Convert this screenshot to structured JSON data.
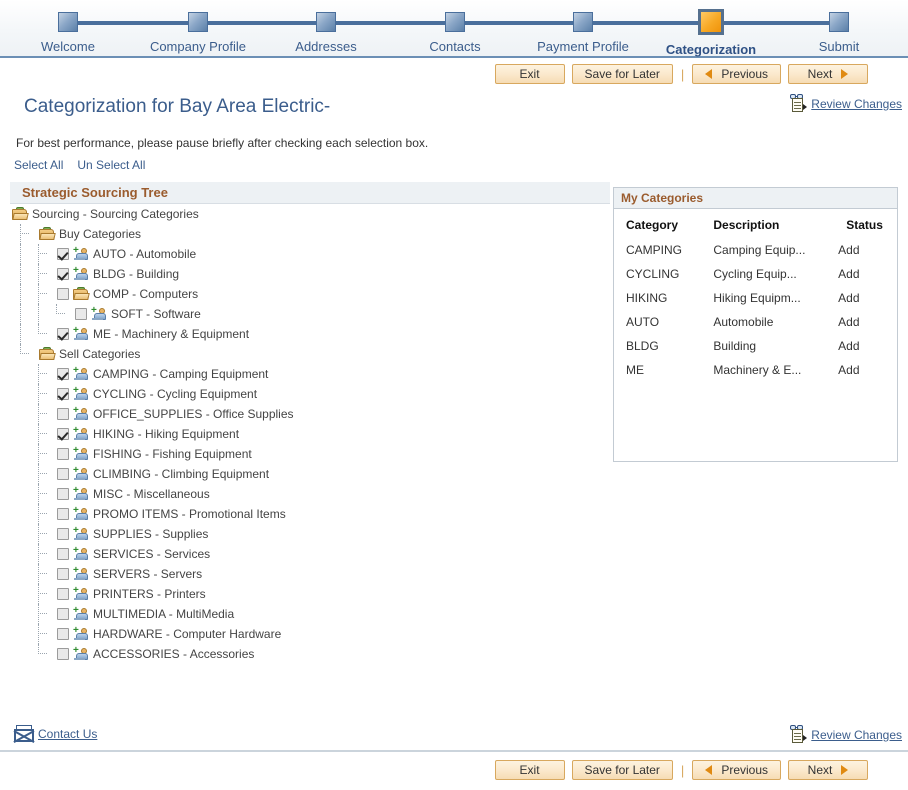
{
  "steps": [
    {
      "label": "Welcome",
      "current": false
    },
    {
      "label": "Company Profile",
      "current": false
    },
    {
      "label": "Addresses",
      "current": false
    },
    {
      "label": "Contacts",
      "current": false
    },
    {
      "label": "Payment Profile",
      "current": false
    },
    {
      "label": "Categorization",
      "current": true
    },
    {
      "label": "Submit",
      "current": false
    }
  ],
  "toolbar": {
    "exit": "Exit",
    "save_for_later": "Save for Later",
    "previous": "Previous",
    "next": "Next",
    "separator": "|"
  },
  "header": {
    "title": "Categorization for Bay Area Electric-",
    "review_changes": "Review Changes",
    "instruction": "For best performance, please pause briefly after checking each selection box.",
    "select_all": "Select All",
    "un_select_all": "Un Select All"
  },
  "tree": {
    "header": "Strategic Sourcing Tree",
    "nodes": [
      {
        "label": "Sourcing - Sourcing Categories",
        "depth": 0,
        "icon": "folder-icon",
        "checkbox": null
      },
      {
        "label": "Buy Categories",
        "depth": 1,
        "icon": "folder-icon",
        "checkbox": null
      },
      {
        "label": "AUTO - Automobile",
        "depth": 2,
        "icon": "category-leaf-icon",
        "checkbox": true
      },
      {
        "label": "BLDG - Building",
        "depth": 2,
        "icon": "category-leaf-icon",
        "checkbox": true
      },
      {
        "label": "COMP - Computers",
        "depth": 2,
        "icon": "folder-icon",
        "checkbox": false
      },
      {
        "label": "SOFT - Software",
        "depth": 3,
        "icon": "category-leaf-icon",
        "checkbox": false
      },
      {
        "label": "ME - Machinery & Equipment",
        "depth": 2,
        "icon": "category-leaf-icon",
        "checkbox": true
      },
      {
        "label": "Sell Categories",
        "depth": 1,
        "icon": "folder-icon",
        "checkbox": null
      },
      {
        "label": "CAMPING - Camping Equipment",
        "depth": 2,
        "icon": "category-leaf-icon",
        "checkbox": true
      },
      {
        "label": "CYCLING - Cycling Equipment",
        "depth": 2,
        "icon": "category-leaf-icon",
        "checkbox": true
      },
      {
        "label": "OFFICE_SUPPLIES - Office Supplies",
        "depth": 2,
        "icon": "category-leaf-icon",
        "checkbox": false
      },
      {
        "label": "HIKING - Hiking Equipment",
        "depth": 2,
        "icon": "category-leaf-icon",
        "checkbox": true
      },
      {
        "label": "FISHING - Fishing Equipment",
        "depth": 2,
        "icon": "category-leaf-icon",
        "checkbox": false
      },
      {
        "label": "CLIMBING - Climbing Equipment",
        "depth": 2,
        "icon": "category-leaf-icon",
        "checkbox": false
      },
      {
        "label": "MISC - Miscellaneous",
        "depth": 2,
        "icon": "category-leaf-icon",
        "checkbox": false
      },
      {
        "label": "PROMO ITEMS - Promotional Items",
        "depth": 2,
        "icon": "category-leaf-icon",
        "checkbox": false
      },
      {
        "label": "SUPPLIES - Supplies",
        "depth": 2,
        "icon": "category-leaf-icon",
        "checkbox": false
      },
      {
        "label": "SERVICES - Services",
        "depth": 2,
        "icon": "category-leaf-icon",
        "checkbox": false
      },
      {
        "label": "SERVERS - Servers",
        "depth": 2,
        "icon": "category-leaf-icon",
        "checkbox": false
      },
      {
        "label": "PRINTERS - Printers",
        "depth": 2,
        "icon": "category-leaf-icon",
        "checkbox": false
      },
      {
        "label": "MULTIMEDIA - MultiMedia",
        "depth": 2,
        "icon": "category-leaf-icon",
        "checkbox": false
      },
      {
        "label": "HARDWARE - Computer Hardware",
        "depth": 2,
        "icon": "category-leaf-icon",
        "checkbox": false
      },
      {
        "label": "ACCESSORIES - Accessories",
        "depth": 2,
        "icon": "category-leaf-icon",
        "checkbox": false
      }
    ]
  },
  "my_categories": {
    "title": "My Categories",
    "columns": [
      "Category",
      "Description",
      "Status"
    ],
    "rows": [
      {
        "category": "CAMPING",
        "description": "Camping Equip...",
        "status": "Add"
      },
      {
        "category": "CYCLING",
        "description": "Cycling Equip...",
        "status": "Add"
      },
      {
        "category": "HIKING",
        "description": "Hiking Equipm...",
        "status": "Add"
      },
      {
        "category": "AUTO",
        "description": "Automobile",
        "status": "Add"
      },
      {
        "category": "BLDG",
        "description": "Building",
        "status": "Add"
      },
      {
        "category": "ME",
        "description": "Machinery & E...",
        "status": "Add"
      }
    ]
  },
  "footer": {
    "contact_us": "Contact Us",
    "review_changes": "Review Changes"
  },
  "colors": {
    "accent_blue": "#3b5d8c",
    "step_current": "#f7a824",
    "panel_header_text": "#9a5b2d",
    "button_face": "#fbe9cd",
    "button_border": "#d8a85e"
  }
}
